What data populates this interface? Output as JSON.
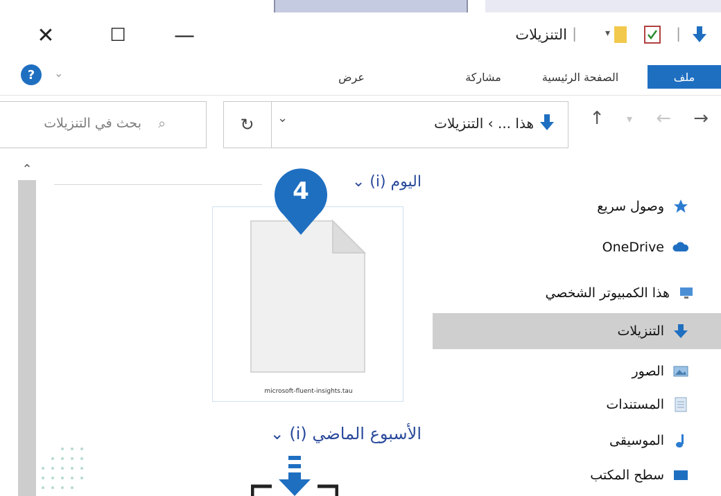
{
  "window": {
    "title": "التنزيلات",
    "controls": {
      "close": "✕",
      "maximize": "☐",
      "minimize": "—"
    }
  },
  "ribbon": {
    "tabs": [
      {
        "label": "ملف"
      },
      {
        "label": "الصفحة الرئيسية"
      },
      {
        "label": "مشاركة"
      },
      {
        "label": "عرض"
      }
    ],
    "help": "?"
  },
  "address_bar": {
    "path": "هذا ... › التنزيلات",
    "path_prefix": "›"
  },
  "search": {
    "placeholder": "بحث في التنزيلات"
  },
  "content": {
    "groups": [
      {
        "label": "اليوم (i)"
      },
      {
        "label": "الأسبوع الماضي (i)"
      }
    ],
    "file": {
      "name": "microsoft-fluent-insights.tau"
    },
    "callout_number": "4"
  },
  "navigation": {
    "items": [
      {
        "label": "وصول سريع",
        "icon": "star-icon"
      },
      {
        "label": "OneDrive",
        "icon": "cloud-icon"
      },
      {
        "label": "هذا الكمبيوتر الشخصي",
        "icon": "computer-icon"
      },
      {
        "label": "التنزيلات",
        "icon": "download-arrow-icon",
        "selected": true
      },
      {
        "label": "الصور",
        "icon": "pictures-icon"
      },
      {
        "label": "المستندات",
        "icon": "documents-icon"
      },
      {
        "label": "الموسيقى",
        "icon": "music-icon"
      },
      {
        "label": "سطح المكتب",
        "icon": "desktop-icon"
      }
    ]
  },
  "colors": {
    "accent": "#1f6fc1",
    "selection": "#cfcfcf",
    "callout": "#1f6fc1",
    "group_header": "#2a4a9a"
  }
}
